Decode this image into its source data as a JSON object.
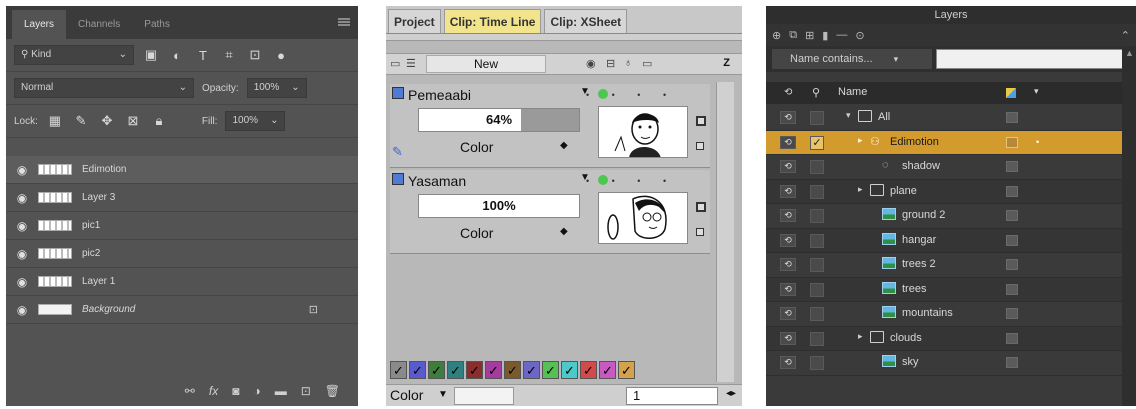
{
  "photoshop": {
    "tabs": [
      "Layers",
      "Channels",
      "Paths"
    ],
    "filter_label": "Kind",
    "blend_mode": "Normal",
    "opacity_label": "Opacity:",
    "opacity_value": "100%",
    "lock_label": "Lock:",
    "fill_label": "Fill:",
    "fill_value": "100%",
    "layers": [
      {
        "name": "Edimotion",
        "selected": true,
        "thumb": "check"
      },
      {
        "name": "Layer 3",
        "selected": false,
        "thumb": "check"
      },
      {
        "name": "pic1",
        "selected": false,
        "thumb": "check"
      },
      {
        "name": "pic2",
        "selected": false,
        "thumb": "check"
      },
      {
        "name": "Layer 1",
        "selected": false,
        "thumb": "check"
      },
      {
        "name": "Background",
        "selected": false,
        "thumb": "white",
        "italic": true,
        "locked": true
      }
    ],
    "bottom_icons": [
      "link-icon",
      "fx-icon",
      "mask-icon",
      "adjustment-icon",
      "folder-icon",
      "new-layer-icon",
      "trash-icon"
    ]
  },
  "timeline": {
    "tabs": [
      "Project",
      "Clip: Time Line",
      "Clip: XSheet"
    ],
    "new_label": "New",
    "z_label": "Z",
    "layers": [
      {
        "name": "Pemeaabi",
        "opacity": "64%",
        "opacity_fraction": 0.64,
        "color_label": "Color"
      },
      {
        "name": "Yasaman",
        "opacity": "100%",
        "opacity_fraction": 1.0,
        "color_label": "Color"
      }
    ],
    "swatch_colors": [
      "#8a8a8a",
      "#5a5acf",
      "#3e7d3e",
      "#2f8080",
      "#8a2d2d",
      "#a53a9f",
      "#7a5a2a",
      "#6c66c4",
      "#55c155",
      "#4ec9c9",
      "#d24b4b",
      "#c759c0",
      "#d2a24c"
    ],
    "bottom_color_label": "Color",
    "frame_value": "1"
  },
  "edimotion": {
    "title": "Layers",
    "search_label": "Name contains...",
    "header_name": "Name",
    "rows": [
      {
        "name": "All",
        "type": "folder",
        "expander": "▾",
        "indent": 0
      },
      {
        "name": "Edimotion",
        "type": "group",
        "expander": "▸",
        "indent": 1,
        "selected": true,
        "checked": true
      },
      {
        "name": "shadow",
        "type": "shape",
        "expander": "",
        "indent": 2
      },
      {
        "name": "plane",
        "type": "folder",
        "expander": "▸",
        "indent": 1
      },
      {
        "name": "ground 2",
        "type": "image",
        "expander": "",
        "indent": 2
      },
      {
        "name": "hangar",
        "type": "image",
        "expander": "",
        "indent": 2
      },
      {
        "name": "trees 2",
        "type": "image",
        "expander": "",
        "indent": 2
      },
      {
        "name": "trees",
        "type": "image",
        "expander": "",
        "indent": 2
      },
      {
        "name": "mountains",
        "type": "image",
        "expander": "",
        "indent": 2
      },
      {
        "name": "clouds",
        "type": "folder",
        "expander": "▸",
        "indent": 1
      },
      {
        "name": "sky",
        "type": "image",
        "expander": "",
        "indent": 2
      }
    ]
  }
}
